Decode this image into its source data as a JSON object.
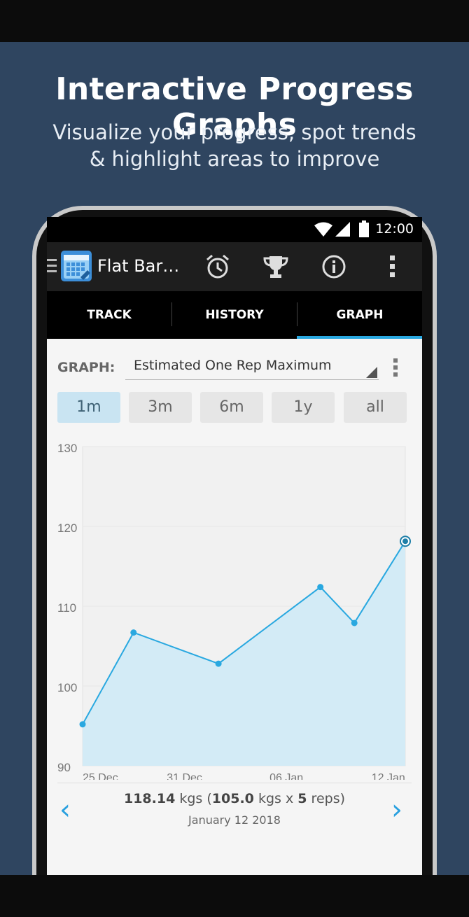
{
  "promo": {
    "headline": "Interactive Progress Graphs",
    "subline_1": "Visualize your progress, spot trends",
    "subline_2": "& highlight areas to improve"
  },
  "status_bar": {
    "time": "12:00",
    "icons": [
      "wifi-icon",
      "signal-icon",
      "battery-icon"
    ]
  },
  "action_bar": {
    "title": "Flat Bar…",
    "icons": [
      "menu-icon",
      "app-calendar-icon",
      "alarm-clock-icon",
      "trophy-icon",
      "info-icon",
      "overflow-menu-icon"
    ]
  },
  "tabs": [
    {
      "label": "TRACK"
    },
    {
      "label": "HISTORY"
    },
    {
      "label": "GRAPH",
      "active": true
    }
  ],
  "graph_selector": {
    "label": "GRAPH:",
    "value": "Estimated One Rep Maximum"
  },
  "ranges": [
    {
      "label": "1m",
      "active": true
    },
    {
      "label": "3m"
    },
    {
      "label": "6m"
    },
    {
      "label": "1y"
    },
    {
      "label": "all"
    }
  ],
  "chart_data": {
    "type": "area",
    "x": [
      "2017-12-25",
      "2017-12-28",
      "2018-01-02",
      "2018-01-08",
      "2018-01-10",
      "2018-01-13"
    ],
    "y": [
      95.2,
      106.7,
      102.8,
      112.4,
      107.9,
      118.14
    ],
    "x_ticks": [
      "25 Dec",
      "31 Dec",
      "06 Jan",
      "12 Jan"
    ],
    "y_ticks": [
      90,
      100,
      110,
      120,
      130
    ],
    "ylim": [
      90,
      130
    ],
    "highlighted_index": 5,
    "line_color": "#29a8e0",
    "fill_color": "#d3ebf6"
  },
  "summary": {
    "value": "118.14",
    "unit": "kgs",
    "weight": "105.0",
    "weight_unit": "kgs",
    "times": "x",
    "reps": "5",
    "reps_label": "reps)",
    "open_paren": "(",
    "date": "January 12 2018"
  },
  "colors": {
    "accent": "#29a8e0",
    "promo_bg": "#2f4560"
  }
}
